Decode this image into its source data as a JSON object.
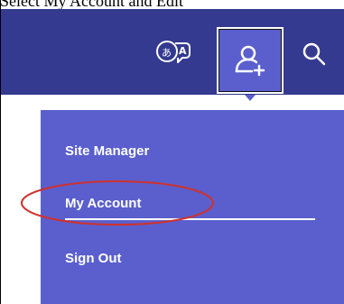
{
  "caption": "Select My Account and Edit",
  "header": {
    "bg_color": "#343a8f",
    "translate_icon": "translate-icon",
    "account_icon": "add-user-icon",
    "search_icon": "search-icon"
  },
  "dropdown": {
    "bg_color": "#5a5fcd",
    "items": [
      {
        "label": "Site Manager"
      },
      {
        "label": "My Account"
      },
      {
        "label": "Sign Out"
      }
    ]
  },
  "annotation": {
    "shape": "ellipse",
    "color": "#d0312d",
    "target": "My Account"
  }
}
